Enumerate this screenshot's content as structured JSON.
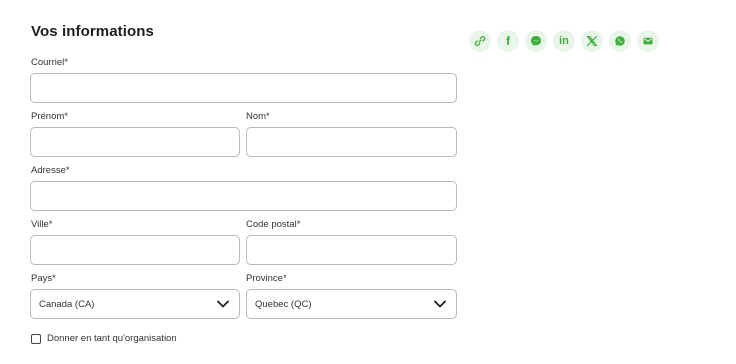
{
  "form": {
    "title": "Vos informations",
    "email_label": "Courriel*",
    "email_value": "",
    "firstname_label": "Prénom*",
    "firstname_value": "",
    "lastname_label": "Nom*",
    "lastname_value": "",
    "address_label": "Adresse*",
    "address_value": "",
    "city_label": "Ville*",
    "city_value": "",
    "postal_label": "Code postal*",
    "postal_value": "",
    "country_label": "Pays*",
    "country_selected": "Canada (CA)",
    "province_label": "Province*",
    "province_selected": "Quebec (QC)",
    "org_checkbox_label": "Donner en tant qu'organisation",
    "org_checked": false
  },
  "share": {
    "icon_color": "#3fae3f",
    "bg_color": "#e8f5e8",
    "facebook_glyph": "f",
    "linkedin_glyph": "in",
    "icons": [
      "link-icon",
      "facebook-icon",
      "messenger-icon",
      "linkedin-icon",
      "x-icon",
      "whatsapp-icon",
      "email-icon"
    ]
  }
}
